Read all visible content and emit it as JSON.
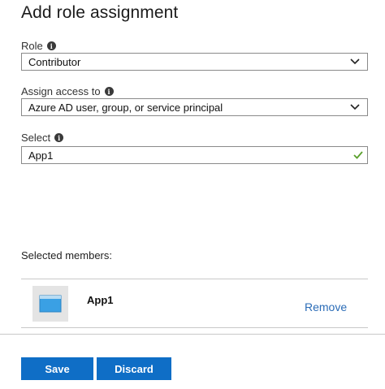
{
  "panel": {
    "title": "Add role assignment"
  },
  "role": {
    "label": "Role",
    "value": "Contributor"
  },
  "assign_access": {
    "label": "Assign access to",
    "value": "Azure AD user, group, or service principal"
  },
  "select": {
    "label": "Select",
    "value": "App1"
  },
  "selected_members": {
    "label": "Selected members:",
    "items": [
      {
        "name": "App1",
        "action": "Remove"
      }
    ]
  },
  "buttons": {
    "save": "Save",
    "discard": "Discard"
  },
  "colors": {
    "accent": "#0f6ec6",
    "link": "#2b6cb7",
    "check": "#5aa02c"
  },
  "icons": [
    "info-icon",
    "chevron-down-icon",
    "checkmark-icon",
    "app-icon"
  ]
}
